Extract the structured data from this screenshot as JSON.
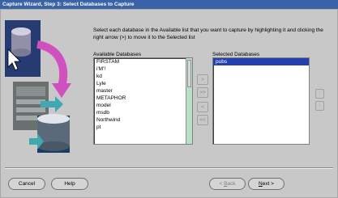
{
  "window": {
    "title": "Capture Wizard, Step  3: Select Databases to Capture"
  },
  "instructions": "Select each database in the Available list that you want to capture by highlighting it and clicking the right arrow (>) to move it to the Selected list",
  "available": {
    "label": "Available Databases",
    "items": [
      "FIRSTAM",
      "i'M'!",
      "kd",
      "Lyle",
      "master",
      "METAPHOR",
      "model",
      "msdb",
      "Northwind",
      "pt"
    ]
  },
  "selected": {
    "label": "Selected Databases",
    "items": [
      "pubs"
    ],
    "selected_index": 0
  },
  "move_buttons": {
    "move_right": ">",
    "move_all_right": ">>",
    "move_left": "<",
    "move_all_left": "<<"
  },
  "order_buttons": {
    "up": "↑",
    "down": "↓"
  },
  "buttons": {
    "cancel": "Cancel",
    "help": "Help",
    "back_prefix": "< ",
    "back_key": "B",
    "back_rest": "ack",
    "next_key": "N",
    "next_rest": "ext",
    "next_suffix": " >"
  },
  "colors": {
    "titlebar": "#3a62a8",
    "selection": "#2440b0",
    "scrollbar": "#b8e0c8"
  }
}
